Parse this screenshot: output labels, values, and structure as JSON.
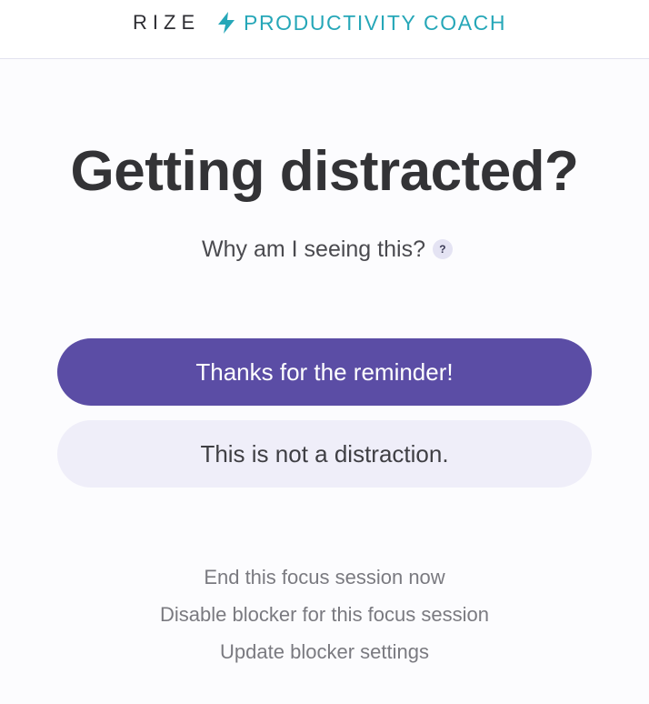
{
  "header": {
    "brand": "RIZE",
    "coach_label": "PRODUCTIVITY COACH",
    "coach_icon": "lightning-bolt-icon"
  },
  "main": {
    "title": "Getting distracted?",
    "why_text": "Why am I seeing this?",
    "help_badge": "?"
  },
  "buttons": {
    "primary_label": "Thanks for the reminder!",
    "secondary_label": "This is not a distraction."
  },
  "links": [
    "End this focus session now",
    "Disable blocker for this focus session",
    "Update blocker settings"
  ],
  "colors": {
    "accent": "#5b4da5",
    "brand_teal": "#26a7b8",
    "secondary_bg": "#efeef9"
  }
}
